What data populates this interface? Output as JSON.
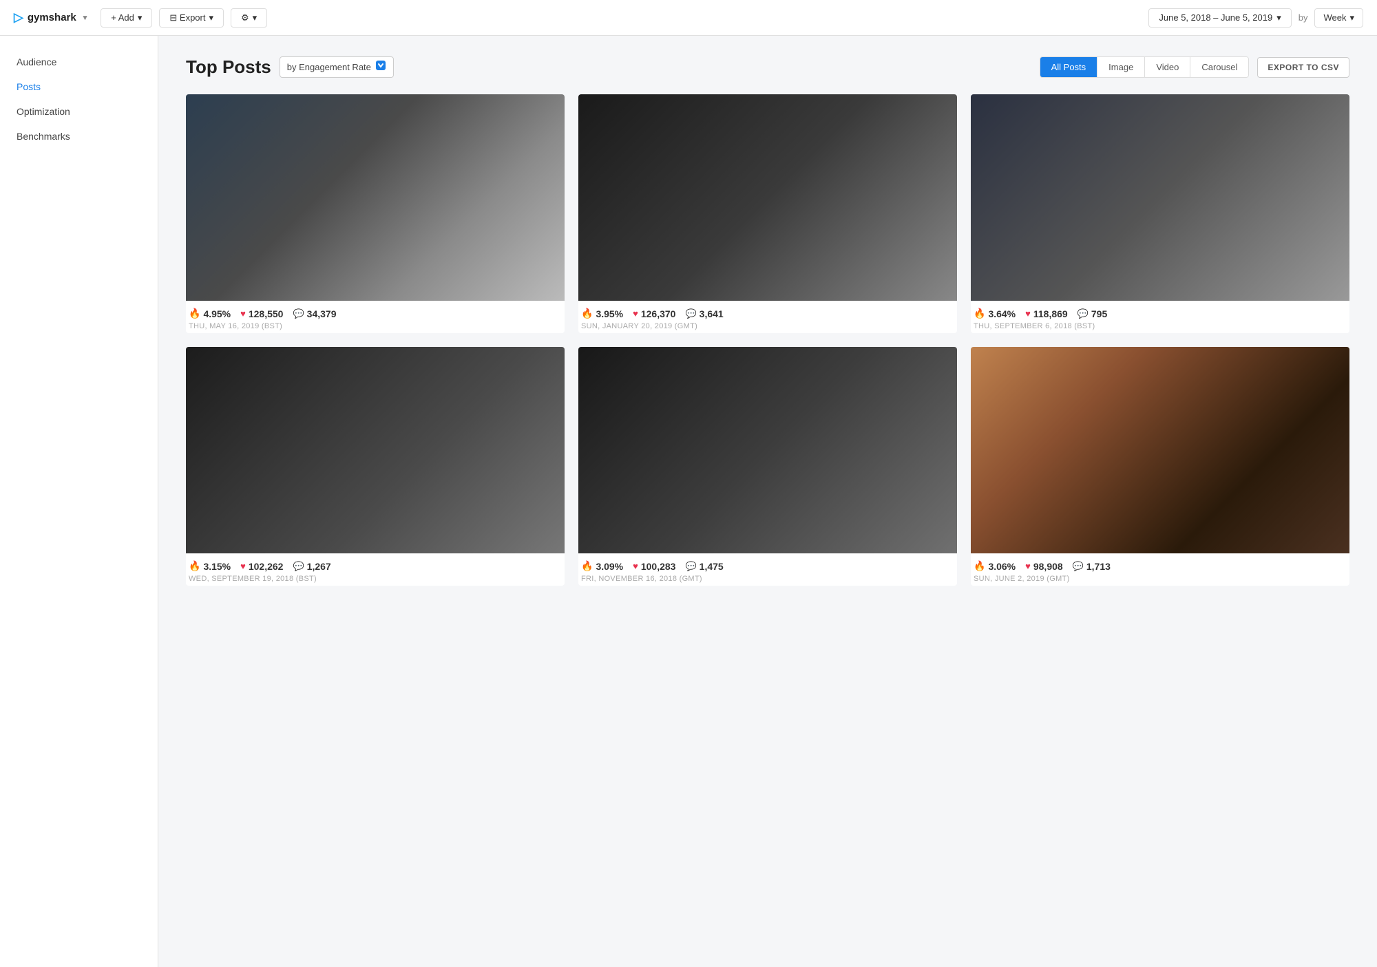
{
  "app": {
    "logo": "gymshark",
    "logo_icon": "▷"
  },
  "nav": {
    "add_label": "+ Add",
    "export_label": "⊟ Export",
    "settings_label": "⚙",
    "date_range": "June 5, 2018 – June 5, 2019",
    "by_label": "by",
    "period_label": "Week"
  },
  "sidebar": {
    "items": [
      {
        "label": "Audience",
        "active": false
      },
      {
        "label": "Posts",
        "active": true
      },
      {
        "label": "Optimization",
        "active": false
      },
      {
        "label": "Benchmarks",
        "active": false
      }
    ]
  },
  "main": {
    "title": "Top Posts",
    "sort_label": "by Engagement Rate",
    "export_csv": "EXPORT TO CSV",
    "filter_tabs": [
      {
        "label": "All Posts",
        "active": true
      },
      {
        "label": "Image",
        "active": false
      },
      {
        "label": "Video",
        "active": false
      },
      {
        "label": "Carousel",
        "active": false
      }
    ],
    "posts": [
      {
        "engagement": "4.95%",
        "likes": "128,550",
        "comments": "34,379",
        "date": "THU, MAY 16, 2019 (BST)",
        "img_class": "img-1"
      },
      {
        "engagement": "3.95%",
        "likes": "126,370",
        "comments": "3,641",
        "date": "SUN, JANUARY 20, 2019 (GMT)",
        "img_class": "img-2"
      },
      {
        "engagement": "3.64%",
        "likes": "118,869",
        "comments": "795",
        "date": "THU, SEPTEMBER 6, 2018 (BST)",
        "img_class": "img-3"
      },
      {
        "engagement": "3.15%",
        "likes": "102,262",
        "comments": "1,267",
        "date": "WED, SEPTEMBER 19, 2018 (BST)",
        "img_class": "img-4"
      },
      {
        "engagement": "3.09%",
        "likes": "100,283",
        "comments": "1,475",
        "date": "FRI, NOVEMBER 16, 2018 (GMT)",
        "img_class": "img-5"
      },
      {
        "engagement": "3.06%",
        "likes": "98,908",
        "comments": "1,713",
        "date": "SUN, JUNE 2, 2019 (GMT)",
        "img_class": "img-6"
      }
    ]
  }
}
